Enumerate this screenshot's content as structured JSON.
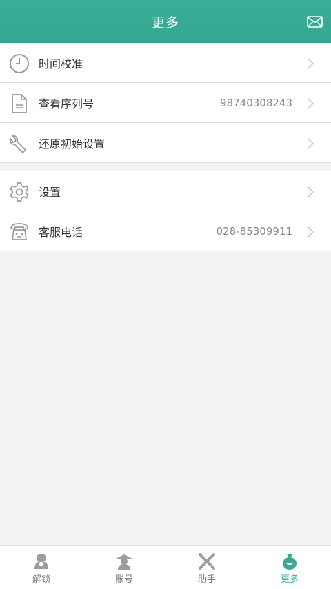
{
  "header": {
    "title": "更多",
    "mail_icon": "mail-icon"
  },
  "section1": {
    "items": [
      {
        "icon": "clock-icon",
        "label": "时间校准",
        "value": ""
      },
      {
        "icon": "document-icon",
        "label": "查看序列号",
        "value": "98740308243"
      },
      {
        "icon": "wrench-icon",
        "label": "还原初始设置",
        "value": ""
      }
    ]
  },
  "section2": {
    "items": [
      {
        "icon": "gear-icon",
        "label": "设置",
        "value": ""
      },
      {
        "icon": "telephone-icon",
        "label": "客服电话",
        "value": "028-85309911"
      }
    ]
  },
  "tabbar": {
    "tabs": [
      {
        "icon": "unlock-icon",
        "label": "解锁"
      },
      {
        "icon": "account-icon",
        "label": "账号"
      },
      {
        "icon": "assistant-icon",
        "label": "助手"
      },
      {
        "icon": "more-bag-icon",
        "label": "更多"
      }
    ],
    "active_index": 3
  },
  "colors": {
    "accent": "#3aa98f",
    "header": "#37ab94",
    "icon_gray": "#9a9a9a"
  }
}
